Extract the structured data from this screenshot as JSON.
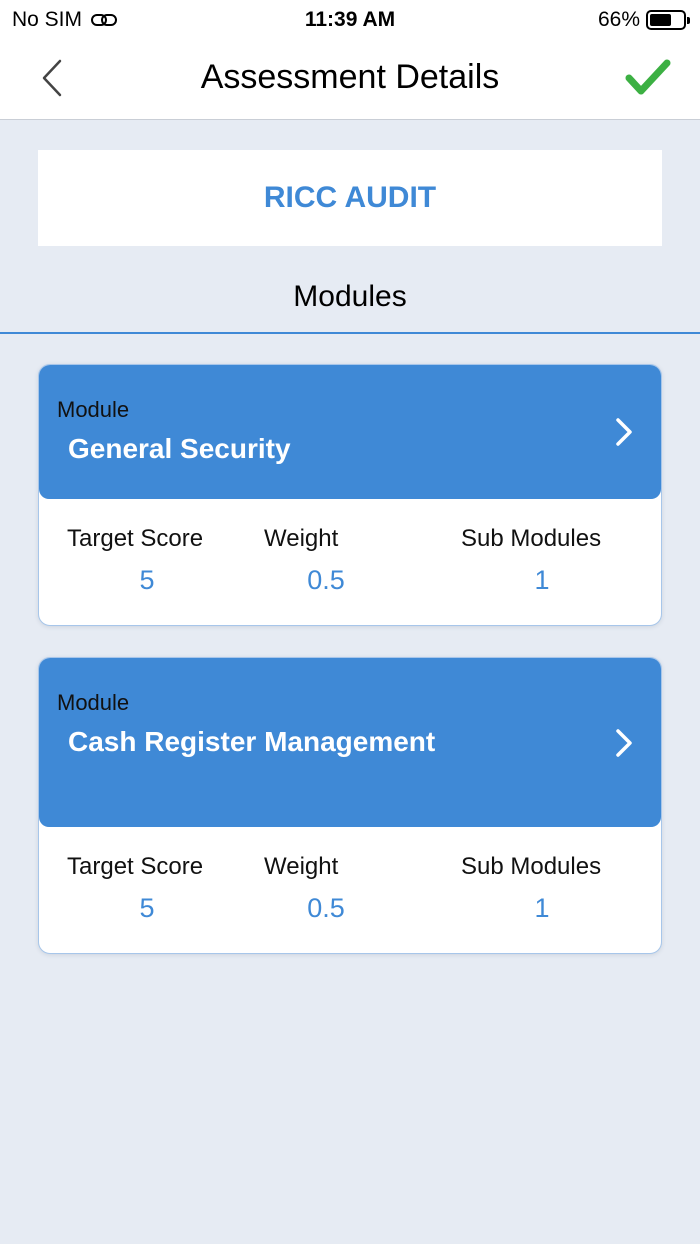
{
  "status_bar": {
    "carrier": "No SIM",
    "time": "11:39 AM",
    "battery": "66%",
    "battery_level": 0.66,
    "link_icon": "link-icon"
  },
  "nav": {
    "title": "Assessment Details",
    "back_icon": "chevron-left-icon",
    "done_icon": "checkmark-icon",
    "done_color": "#3cb043"
  },
  "assessment": {
    "name": "RICC AUDIT"
  },
  "section": {
    "title": "Modules"
  },
  "modules": [
    {
      "label": "Module",
      "name": "General Security",
      "target_score_label": "Target Score",
      "target_score": "5",
      "weight_label": "Weight",
      "weight": "0.5",
      "sub_modules_label": "Sub Modules",
      "sub_modules": "1"
    },
    {
      "label": "Module",
      "name": "Cash Register Management",
      "target_score_label": "Target Score",
      "target_score": "5",
      "weight_label": "Weight",
      "weight": "0.5",
      "sub_modules_label": "Sub Modules",
      "sub_modules": "1"
    }
  ],
  "colors": {
    "accent": "#3f89d6",
    "background": "#e6ebf3"
  }
}
